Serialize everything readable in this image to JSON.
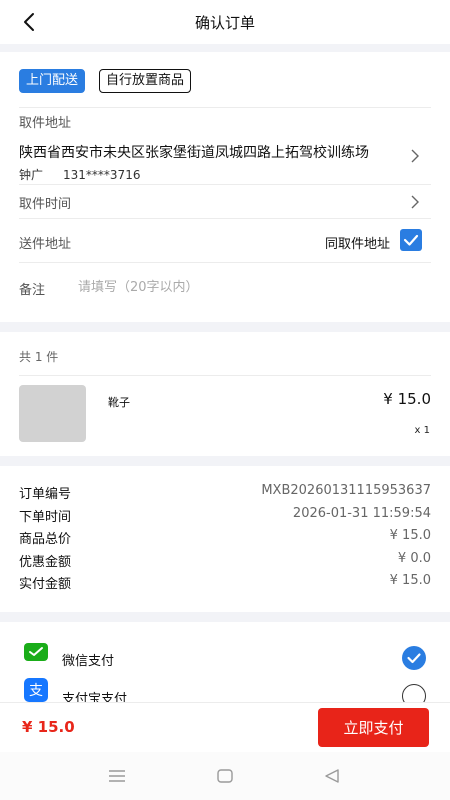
{
  "header": {
    "title": "确认订单"
  },
  "delivery": {
    "tabs": [
      {
        "label": "上门配送",
        "active": true
      },
      {
        "label": "自行放置商品",
        "active": false
      }
    ],
    "pickup_address_label": "取件地址",
    "pickup_address": "陕西省西安市未央区张家堡街道凤城四路上拓驾校训练场",
    "contact_name": "钟广",
    "contact_phone": "131****3716",
    "pickup_time_label": "取件时间",
    "delivery_address_label": "送件地址",
    "same_as_pickup_label": "同取件地址",
    "same_as_pickup_checked": true,
    "remark_label": "备注",
    "remark_placeholder": "请填写（20字以内）",
    "remark_value": ""
  },
  "items": {
    "count_label": "共 1 件",
    "list": [
      {
        "name": "靴子",
        "price": "¥ 15.0",
        "qty": "x 1"
      }
    ]
  },
  "order": {
    "rows": [
      {
        "key": "订单编号",
        "value": "MXB20260131115953637"
      },
      {
        "key": "下单时间",
        "value": "2026-01-31 11:59:54"
      },
      {
        "key": "商品总价",
        "value": "¥ 15.0"
      },
      {
        "key": "优惠金额",
        "value": "¥ 0.0"
      },
      {
        "key": "实付金额",
        "value": "¥ 15.0"
      }
    ]
  },
  "payment": {
    "methods": [
      {
        "label": "微信支付",
        "icon": "wechat-pay-icon",
        "selected": true
      },
      {
        "label": "支付宝支付",
        "icon": "alipay-icon",
        "selected": false
      }
    ]
  },
  "bottom": {
    "total": "¥ 15.0",
    "pay_button": "立即支付"
  },
  "colors": {
    "accent": "#2a7de1",
    "primary_red": "#e82419",
    "wechat_green": "#1aad19",
    "alipay_blue": "#1677ff"
  }
}
